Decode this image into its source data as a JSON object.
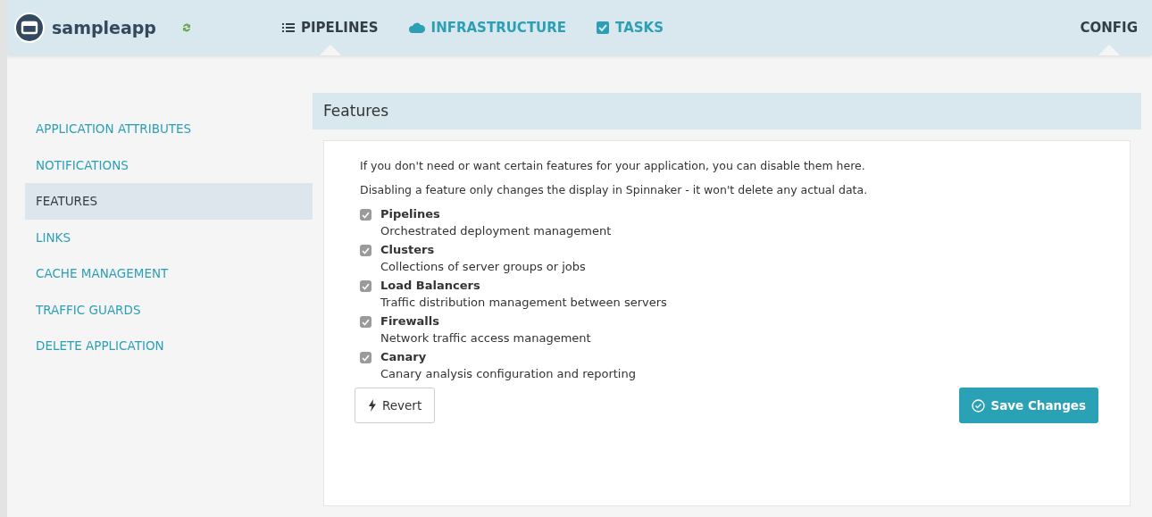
{
  "header": {
    "app_name": "sampleapp",
    "nav": [
      {
        "label": "PIPELINES",
        "selected": true
      },
      {
        "label": "INFRASTRUCTURE",
        "selected": false
      },
      {
        "label": "TASKS",
        "selected": false
      }
    ],
    "config": {
      "label": "CONFIG",
      "selected": true
    }
  },
  "sidebar": {
    "items": [
      {
        "label": "APPLICATION ATTRIBUTES",
        "selected": false
      },
      {
        "label": "NOTIFICATIONS",
        "selected": false
      },
      {
        "label": "FEATURES",
        "selected": true
      },
      {
        "label": "LINKS",
        "selected": false
      },
      {
        "label": "CACHE MANAGEMENT",
        "selected": false
      },
      {
        "label": "TRAFFIC GUARDS",
        "selected": false
      },
      {
        "label": "DELETE APPLICATION",
        "selected": false
      }
    ]
  },
  "panel": {
    "title": "Features",
    "intro": [
      "If you don't need or want certain features for your application, you can disable them here.",
      "Disabling a feature only changes the display in Spinnaker - it won't delete any actual data."
    ],
    "features": [
      {
        "name": "Pipelines",
        "description": "Orchestrated deployment management",
        "checked": true
      },
      {
        "name": "Clusters",
        "description": "Collections of server groups or jobs",
        "checked": true
      },
      {
        "name": "Load Balancers",
        "description": "Traffic distribution management between servers",
        "checked": true
      },
      {
        "name": "Firewalls",
        "description": "Network traffic access management",
        "checked": true
      },
      {
        "name": "Canary",
        "description": "Canary analysis configuration and reporting",
        "checked": true
      }
    ],
    "revert_button": "Revert",
    "save_button": "Save Changes"
  }
}
